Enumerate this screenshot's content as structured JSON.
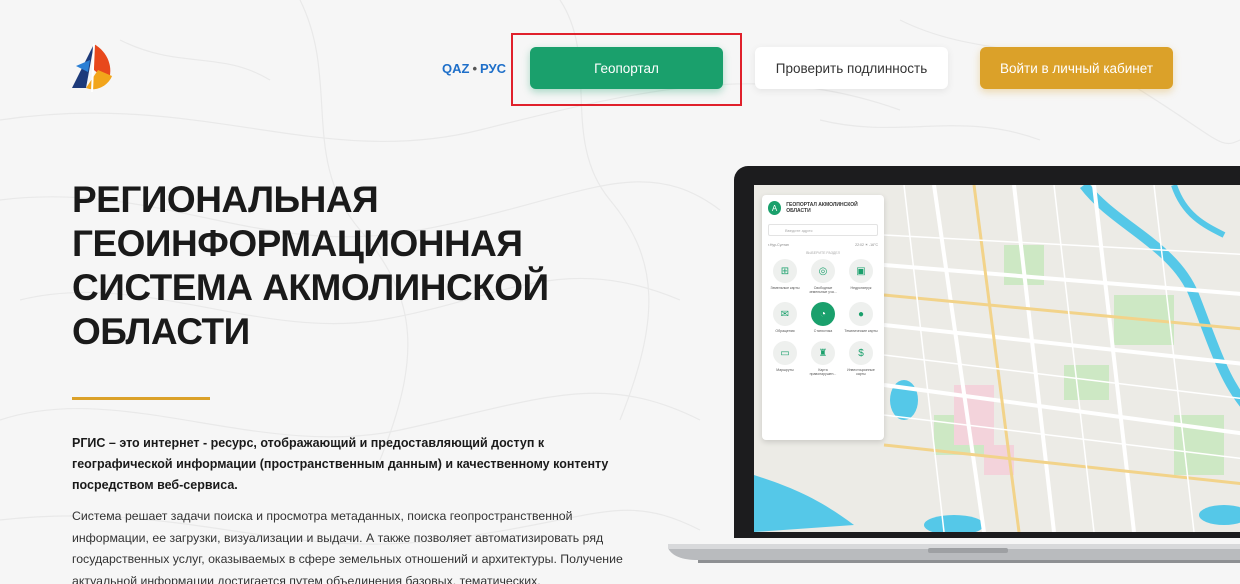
{
  "header": {
    "lang_qaz": "QAZ",
    "lang_sep": "•",
    "lang_rus": "РУС",
    "geoportal_label": "Геопортал",
    "verify_label": "Проверить подлинность",
    "login_label": "Войти в личный кабинет"
  },
  "hero": {
    "title_lines": [
      "РЕГИОНАЛЬНАЯ",
      "ГЕОИНФОРМАЦИОННАЯ",
      "СИСТЕМА АКМОЛИНСКОЙ",
      "ОБЛАСТИ"
    ],
    "lead": "РГИС – это интернет - ресурс, отображающий и предоставляющий доступ к географической информации (пространственным данным) и качественному контенту посредством веб-сервиса.",
    "body": "Система решает задачи поиска и просмотра метаданных, поиска геопространственной информации, ее загрузки, визуализации и выдачи. А также позволяет автоматизировать ряд государственных услуг, оказываемых в сфере земельных отношений и архитектуры. Получение актуальной информации достигается путем объединения базовых, тематических,"
  },
  "mock_panel": {
    "title": "ГЕОПОРТАЛ АКМОЛИНСКОЙ ОБЛАСТИ",
    "search_placeholder": "Введите адрес",
    "meta_left": "г.Нур-Султан",
    "meta_right": "22:02  ☀ -16°C",
    "subtitle": "ВЫБЕРИТЕ РАЗДЕЛ",
    "tiles": [
      {
        "label": "Земельные карты",
        "icon": "land-map-icon"
      },
      {
        "label": "Свободные земельные уча...",
        "icon": "free-land-icon"
      },
      {
        "label": "Недропатрук",
        "icon": "subsoil-icon"
      },
      {
        "label": "Обращения",
        "icon": "requests-icon"
      },
      {
        "label": "Статистика",
        "icon": "statistics-icon"
      },
      {
        "label": "Тематические карты",
        "icon": "thematic-map-icon"
      },
      {
        "label": "Маршруты",
        "icon": "routes-icon"
      },
      {
        "label": "Карта правонарушен...",
        "icon": "violations-icon"
      },
      {
        "label": "Инвестиционные карты",
        "icon": "investment-icon"
      }
    ]
  },
  "colors": {
    "green": "#1aa06c",
    "gold": "#dba129",
    "link_blue": "#1e6fc9",
    "highlight_red": "#e0202b"
  }
}
